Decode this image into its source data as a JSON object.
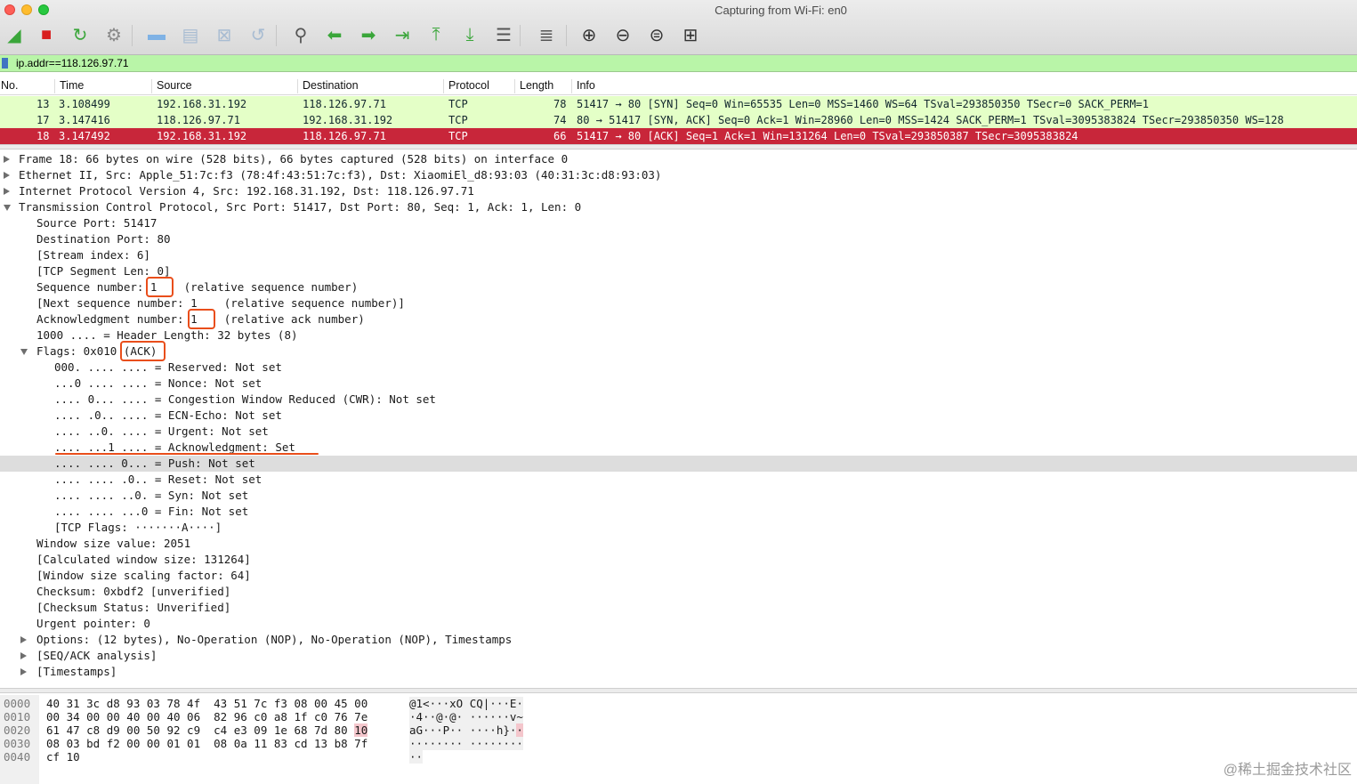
{
  "window": {
    "title": "Capturing from Wi-Fi: en0"
  },
  "toolbar": {
    "buttons": [
      {
        "icon": "shark-fin-start-icon",
        "color": "#3aa63a"
      },
      {
        "icon": "stop-square-icon",
        "color": "#d81e1e"
      },
      {
        "icon": "restart-fin-icon",
        "color": "#3aa63a"
      },
      {
        "icon": "gear-options-icon",
        "color": "#8a8a8a"
      },
      {
        "icon": "folder-open-icon",
        "color": "#7fb2e5"
      },
      {
        "icon": "save-file-icon",
        "color": "#a8bcd2"
      },
      {
        "icon": "close-file-icon",
        "color": "#a8bcd2"
      },
      {
        "icon": "reload-file-icon",
        "color": "#a8bcd2"
      },
      {
        "icon": "find-packet-icon",
        "color": "#555555"
      },
      {
        "icon": "go-back-arrow-icon",
        "color": "#3aa63a"
      },
      {
        "icon": "go-forward-arrow-icon",
        "color": "#3aa63a"
      },
      {
        "icon": "go-to-packet-icon",
        "color": "#3aa63a"
      },
      {
        "icon": "first-packet-icon",
        "color": "#3aa63a"
      },
      {
        "icon": "last-packet-icon",
        "color": "#3aa63a"
      },
      {
        "icon": "autoscroll-icon",
        "color": "#555555"
      },
      {
        "icon": "colorize-icon",
        "color": "#555555"
      },
      {
        "icon": "zoom-in-icon",
        "color": "#333333"
      },
      {
        "icon": "zoom-out-icon",
        "color": "#333333"
      },
      {
        "icon": "normal-size-icon",
        "color": "#333333"
      },
      {
        "icon": "resize-columns-icon",
        "color": "#333333"
      }
    ]
  },
  "filter": {
    "value": "ip.addr==118.126.97.71",
    "bg_color": "#b9f5a8"
  },
  "packet_list": {
    "columns": [
      "No.",
      "Time",
      "Source",
      "Destination",
      "Protocol",
      "Length",
      "Info"
    ],
    "rows": [
      {
        "no": "13",
        "time": "3.108499",
        "source": "192.168.31.192",
        "destination": "118.126.97.71",
        "protocol": "TCP",
        "length": "78",
        "info": "51417 → 80 [SYN] Seq=0 Win=65535 Len=0 MSS=1460 WS=64 TSval=293850350 TSecr=0 SACK_PERM=1"
      },
      {
        "no": "17",
        "time": "3.147416",
        "source": "118.126.97.71",
        "destination": "192.168.31.192",
        "protocol": "TCP",
        "length": "74",
        "info": "80 → 51417 [SYN, ACK] Seq=0 Ack=1 Win=28960 Len=0 MSS=1424 SACK_PERM=1 TSval=3095383824 TSecr=293850350 WS=128"
      },
      {
        "no": "18",
        "time": "3.147492",
        "source": "192.168.31.192",
        "destination": "118.126.97.71",
        "protocol": "TCP",
        "length": "66",
        "info": "51417 → 80 [ACK] Seq=1 Ack=1 Win=131264 Len=0 TSval=293850387 TSecr=3095383824"
      }
    ],
    "colors": {
      "tcp_row": "#e4ffc7",
      "selected_row": "#c8263a"
    }
  },
  "details": {
    "lines": [
      {
        "text": "Frame 18: 66 bytes on wire (528 bits), 66 bytes captured (528 bits) on interface 0",
        "expander": "collapsed",
        "level": 0
      },
      {
        "text": "Ethernet II, Src: Apple_51:7c:f3 (78:4f:43:51:7c:f3), Dst: XiaomiEl_d8:93:03 (40:31:3c:d8:93:03)",
        "expander": "collapsed",
        "level": 0
      },
      {
        "text": "Internet Protocol Version 4, Src: 192.168.31.192, Dst: 118.126.97.71",
        "expander": "collapsed",
        "level": 0
      },
      {
        "text": "Transmission Control Protocol, Src Port: 51417, Dst Port: 80, Seq: 1, Ack: 1, Len: 0",
        "expander": "expanded",
        "level": 0
      },
      {
        "text": "Source Port: 51417",
        "expander": "none",
        "level": 1
      },
      {
        "text": "Destination Port: 80",
        "expander": "none",
        "level": 1
      },
      {
        "text": "[Stream index: 6]",
        "expander": "none",
        "level": 1
      },
      {
        "text": "[TCP Segment Len: 0]",
        "expander": "none",
        "level": 1
      },
      {
        "text": "Sequence number: 1    (relative sequence number)",
        "expander": "none",
        "level": 1
      },
      {
        "text": "[Next sequence number: 1    (relative sequence number)]",
        "expander": "none",
        "level": 1
      },
      {
        "text": "Acknowledgment number: 1    (relative ack number)",
        "expander": "none",
        "level": 1
      },
      {
        "text": "1000 .... = Header Length: 32 bytes (8)",
        "expander": "none",
        "level": 1
      },
      {
        "text": "Flags: 0x010 (ACK)",
        "expander": "expanded",
        "level": 1
      },
      {
        "text": "000. .... .... = Reserved: Not set",
        "expander": "none",
        "level": 2
      },
      {
        "text": "...0 .... .... = Nonce: Not set",
        "expander": "none",
        "level": 2
      },
      {
        "text": ".... 0... .... = Congestion Window Reduced (CWR): Not set",
        "expander": "none",
        "level": 2
      },
      {
        "text": ".... .0.. .... = ECN-Echo: Not set",
        "expander": "none",
        "level": 2
      },
      {
        "text": ".... ..0. .... = Urgent: Not set",
        "expander": "none",
        "level": 2
      },
      {
        "text": ".... ...1 .... = Acknowledgment: Set",
        "expander": "none",
        "level": 2
      },
      {
        "text": ".... .... 0... = Push: Not set",
        "expander": "none",
        "level": 2
      },
      {
        "text": ".... .... .0.. = Reset: Not set",
        "expander": "none",
        "level": 2
      },
      {
        "text": ".... .... ..0. = Syn: Not set",
        "expander": "none",
        "level": 2
      },
      {
        "text": ".... .... ...0 = Fin: Not set",
        "expander": "none",
        "level": 2
      },
      {
        "text": "[TCP Flags: ·······A····]",
        "expander": "none",
        "level": 2
      },
      {
        "text": "Window size value: 2051",
        "expander": "none",
        "level": 1
      },
      {
        "text": "[Calculated window size: 131264]",
        "expander": "none",
        "level": 1
      },
      {
        "text": "[Window size scaling factor: 64]",
        "expander": "none",
        "level": 1
      },
      {
        "text": "Checksum: 0xbdf2 [unverified]",
        "expander": "none",
        "level": 1
      },
      {
        "text": "[Checksum Status: Unverified]",
        "expander": "none",
        "level": 1
      },
      {
        "text": "Urgent pointer: 0",
        "expander": "none",
        "level": 1
      },
      {
        "text": "Options: (12 bytes), No-Operation (NOP), No-Operation (NOP), Timestamps",
        "expander": "collapsed",
        "level": 1
      },
      {
        "text": "[SEQ/ACK analysis]",
        "expander": "collapsed",
        "level": 1
      },
      {
        "text": "[Timestamps]",
        "expander": "collapsed",
        "level": 1
      }
    ],
    "highlighted_line_index": 19,
    "annotation_color": "#e94e1b"
  },
  "bytes": {
    "rows": [
      {
        "offset": "0000",
        "hex": "40 31 3c d8 93 03 78 4f  43 51 7c f3 08 00 45 00",
        "ascii": "@1<···xO CQ|···E·"
      },
      {
        "offset": "0010",
        "hex": "00 34 00 00 40 00 40 06  82 96 c0 a8 1f c0 76 7e",
        "ascii": "·4··@·@· ······v~"
      },
      {
        "offset": "0020",
        "hex": "61 47 c8 d9 00 50 92 c9  c4 e3 09 1e 68 7d 80 ",
        "hex_hl": "10",
        "ascii": "aG···P·· ····h}·",
        "ascii_hl": "·"
      },
      {
        "offset": "0030",
        "hex": "08 03 bd f2 00 00 01 01  08 0a 11 83 cd 13 b8 7f",
        "ascii": "········ ········"
      },
      {
        "offset": "0040",
        "hex": "cf 10",
        "ascii": "··"
      }
    ]
  },
  "watermark": "@稀土掘金技术社区"
}
